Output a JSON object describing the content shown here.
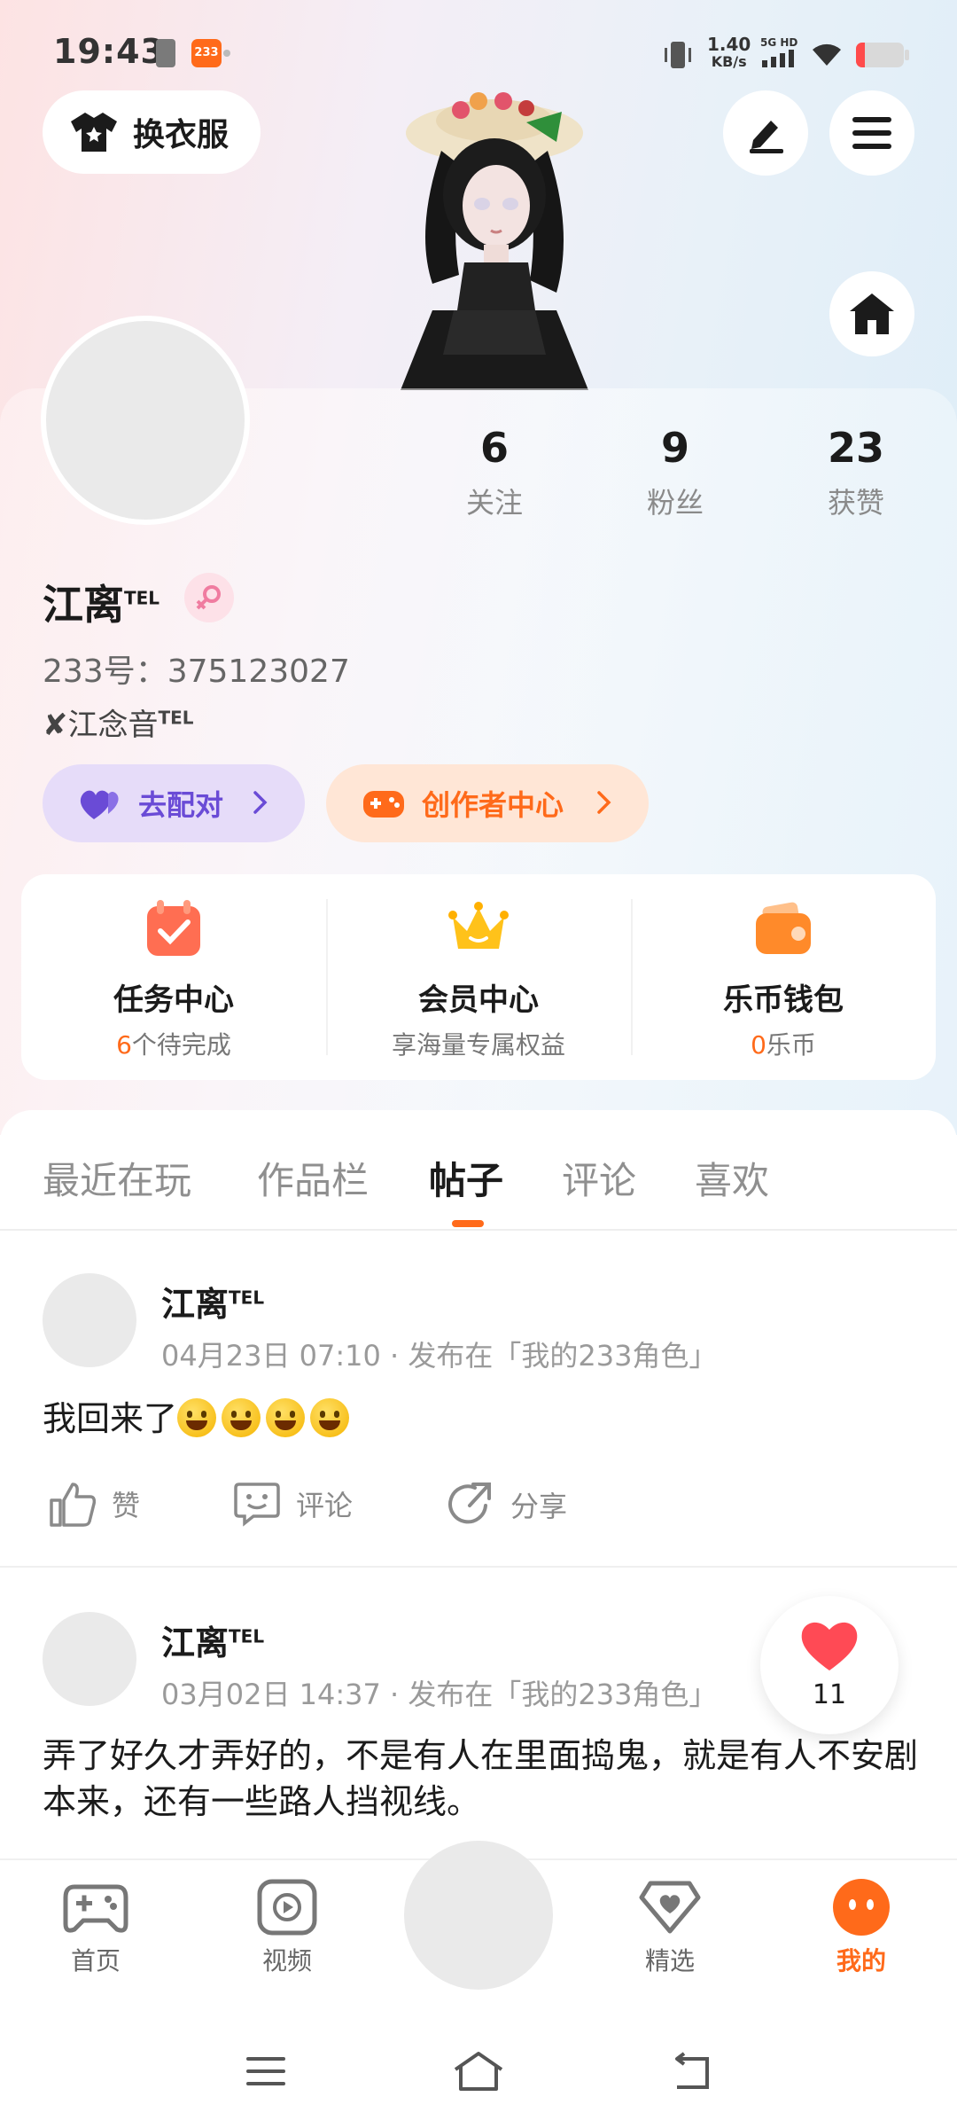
{
  "status_bar": {
    "time": "19:43",
    "app_badge": "233",
    "net_speed_value": "1.40",
    "net_speed_unit": "KB/s",
    "network": "5G HD",
    "battery_color": "#ff4b4b",
    "battery_level": 0.18
  },
  "top": {
    "outfit_label": "换衣服",
    "edit_icon": "pen-icon",
    "menu_icon": "hamburger-menu-icon",
    "home_icon": "home-icon"
  },
  "profile": {
    "name": "江离",
    "name_tag": "TEL",
    "gender_icon": "female-symbol-icon",
    "uid": "233号：375123027",
    "bio_prefix": "✘江念音",
    "bio_tag": "TEL",
    "stats": [
      {
        "value": "6",
        "label": "关注"
      },
      {
        "value": "9",
        "label": "粉丝"
      },
      {
        "value": "23",
        "label": "获赞"
      }
    ],
    "match_label": "去配对",
    "creator_label": "创作者中心"
  },
  "features": [
    {
      "title": "任务中心",
      "highlight": "6",
      "sub": "个待完成",
      "icon": "task-calendar-icon"
    },
    {
      "title": "会员中心",
      "highlight": "",
      "sub": "享海量专属权益",
      "icon": "crown-icon"
    },
    {
      "title": "乐币钱包",
      "highlight": "0",
      "sub": "乐币",
      "icon": "wallet-icon"
    }
  ],
  "tabs": [
    "最近在玩",
    "作品栏",
    "帖子",
    "评论",
    "喜欢"
  ],
  "active_tab": "帖子",
  "posts": [
    {
      "author": "江离",
      "author_tag": "TEL",
      "meta": "04月23日 07:10 · 发布在「我的233角色」",
      "text": "我回来了",
      "emoji_count": 4,
      "actions": {
        "like": "赞",
        "comment": "评论",
        "share": "分享"
      }
    },
    {
      "author": "江离",
      "author_tag": "TEL",
      "meta": "03月02日 14:37 · 发布在「我的233角色」",
      "text": "弄了好久才弄好的，不是有人在里面捣鬼，就是有人不安剧本来，还有一些路人挡视线。"
    }
  ],
  "floating_like": {
    "count": "11"
  },
  "bottom_nav": [
    {
      "label": "首页",
      "icon": "gamepad-icon"
    },
    {
      "label": "视频",
      "icon": "video-play-icon"
    },
    {
      "label": "精选",
      "icon": "heart-diamond-icon"
    },
    {
      "label": "我的",
      "icon": "face-icon"
    }
  ],
  "colors": {
    "accent": "#ff6a1a",
    "match_purple": "#6a4bd6"
  }
}
